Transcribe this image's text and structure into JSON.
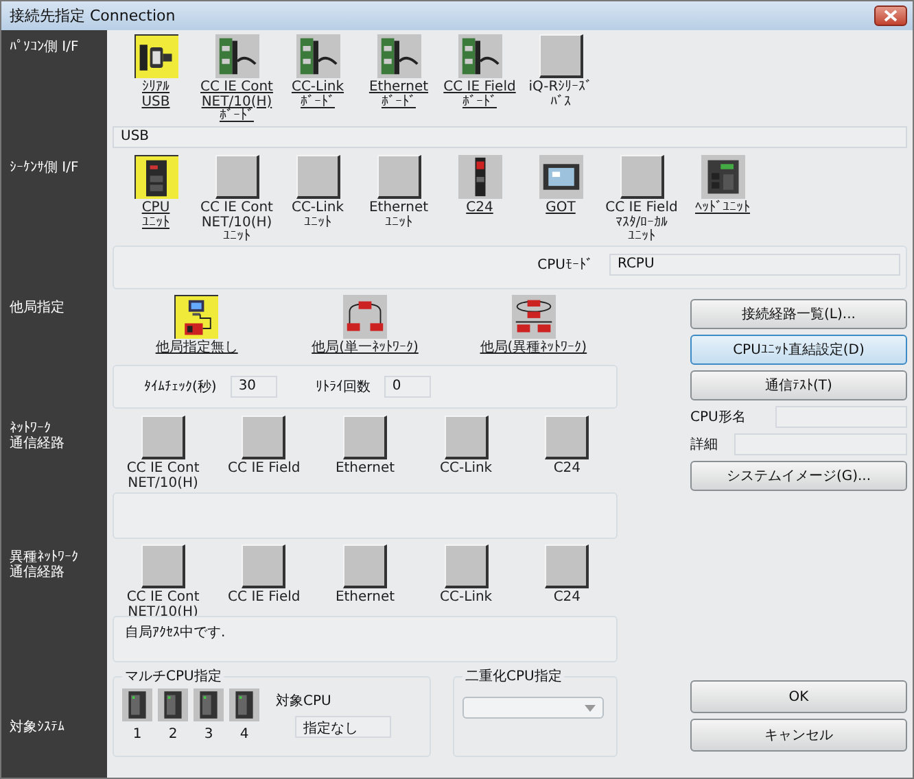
{
  "window": {
    "title": "接続先指定 Connection"
  },
  "pc_side": {
    "label": [
      "ﾊﾟｿｺﾝ側 I/F"
    ],
    "value": "USB",
    "items": [
      {
        "lines": [
          "ｼﾘｱﾙ",
          "USB"
        ],
        "kind": "serial",
        "selected": true,
        "enabled": true
      },
      {
        "lines": [
          "CC IE Cont",
          "NET/10(H)",
          "ﾎﾞｰﾄﾞ"
        ],
        "kind": "board",
        "selected": false,
        "enabled": true
      },
      {
        "lines": [
          "CC-Link",
          "ﾎﾞｰﾄﾞ"
        ],
        "kind": "board",
        "selected": false,
        "enabled": true
      },
      {
        "lines": [
          "Ethernet",
          "ﾎﾞｰﾄﾞ"
        ],
        "kind": "board",
        "selected": false,
        "enabled": true
      },
      {
        "lines": [
          "CC IE Field",
          "ﾎﾞｰﾄﾞ"
        ],
        "kind": "board",
        "selected": false,
        "enabled": true
      },
      {
        "lines": [
          "iQ-Rｼﾘｰｽﾞ",
          "ﾊﾞｽ"
        ],
        "kind": "blank",
        "selected": false,
        "enabled": false
      }
    ]
  },
  "plc_side": {
    "label": [
      "ｼｰｹﾝｻ側 I/F"
    ],
    "cpu_mode_label": "CPUﾓｰﾄﾞ",
    "cpu_mode": "RCPU",
    "items": [
      {
        "lines": [
          "CPU",
          "ﾕﾆｯﾄ"
        ],
        "kind": "cpu",
        "selected": true,
        "enabled": true
      },
      {
        "lines": [
          "CC IE Cont",
          "NET/10(H)",
          "ﾕﾆｯﾄ"
        ],
        "kind": "blank",
        "selected": false,
        "enabled": false
      },
      {
        "lines": [
          "CC-Link",
          "ﾕﾆｯﾄ"
        ],
        "kind": "blank",
        "selected": false,
        "enabled": false
      },
      {
        "lines": [
          "Ethernet",
          "ﾕﾆｯﾄ"
        ],
        "kind": "blank",
        "selected": false,
        "enabled": false
      },
      {
        "lines": [
          "C24"
        ],
        "kind": "module",
        "selected": false,
        "enabled": true
      },
      {
        "lines": [
          "GOT"
        ],
        "kind": "panel",
        "selected": false,
        "enabled": true
      },
      {
        "lines": [
          "CC IE Field",
          "ﾏｽﾀ/ﾛｰｶﾙ",
          "ﾕﾆｯﾄ"
        ],
        "kind": "blank",
        "selected": false,
        "enabled": false
      },
      {
        "lines": [
          "ﾍｯﾄﾞﾕﾆｯﾄ"
        ],
        "kind": "head",
        "selected": false,
        "enabled": true
      }
    ]
  },
  "other_station": {
    "label": [
      "他局指定"
    ],
    "time_check_label": "ﾀｲﾑﾁｪｯｸ(秒)",
    "time_check": "30",
    "retry_label": "ﾘﾄﾗｲ回数",
    "retry": "0",
    "items": [
      {
        "lines": [
          "他局指定無し"
        ],
        "kind": "local",
        "selected": true,
        "enabled": true
      },
      {
        "lines": [
          "他局(単一ﾈｯﾄﾜｰｸ)"
        ],
        "kind": "single-net",
        "selected": false,
        "enabled": true
      },
      {
        "lines": [
          "他局(異種ﾈｯﾄﾜｰｸ)"
        ],
        "kind": "multi-net",
        "selected": false,
        "enabled": true
      }
    ]
  },
  "network_route": {
    "label": [
      "ﾈｯﾄﾜｰｸ",
      "通信経路"
    ],
    "items": [
      {
        "lines": [
          "CC IE Cont",
          "NET/10(H)"
        ],
        "kind": "blank",
        "selected": false,
        "enabled": false
      },
      {
        "lines": [
          "CC IE Field"
        ],
        "kind": "blank",
        "selected": false,
        "enabled": false
      },
      {
        "lines": [
          "Ethernet"
        ],
        "kind": "blank",
        "selected": false,
        "enabled": false
      },
      {
        "lines": [
          "CC-Link"
        ],
        "kind": "blank",
        "selected": false,
        "enabled": false
      },
      {
        "lines": [
          "C24"
        ],
        "kind": "blank",
        "selected": false,
        "enabled": false
      }
    ]
  },
  "other_network_route": {
    "label": [
      "異種ﾈｯﾄﾜｰｸ",
      "通信経路"
    ],
    "message": "自局ｱｸｾｽ中です.",
    "items": [
      {
        "lines": [
          "CC IE Cont",
          "NET/10(H)"
        ],
        "kind": "blank",
        "selected": false,
        "enabled": false
      },
      {
        "lines": [
          "CC IE Field"
        ],
        "kind": "blank",
        "selected": false,
        "enabled": false
      },
      {
        "lines": [
          "Ethernet"
        ],
        "kind": "blank",
        "selected": false,
        "enabled": false
      },
      {
        "lines": [
          "CC-Link"
        ],
        "kind": "blank",
        "selected": false,
        "enabled": false
      },
      {
        "lines": [
          "C24"
        ],
        "kind": "blank",
        "selected": false,
        "enabled": false
      }
    ]
  },
  "target_system": {
    "label": [
      "対象ｼｽﾃﾑ"
    ],
    "multi_cpu": {
      "title": "マルチCPU指定",
      "target_label": "対象CPU",
      "target": "指定なし",
      "cpus": [
        {
          "label": "1"
        },
        {
          "label": "2"
        },
        {
          "label": "3"
        },
        {
          "label": "4"
        }
      ]
    },
    "redundant_cpu": {
      "title": "二重化CPU指定"
    }
  },
  "side": {
    "buttons": [
      {
        "label": "接続経路一覧(L)...",
        "focused": false
      },
      {
        "label": "CPUﾕﾆｯﾄ直結設定(D)",
        "focused": true
      },
      {
        "label": "通信ﾃｽﾄ(T)",
        "focused": false
      }
    ],
    "cpu_type_label": "CPU形名",
    "detail_label": "詳細",
    "system_image_button": "システムイメージ(G)..."
  },
  "dialog_buttons": [
    "OK",
    "キャンセル"
  ]
}
